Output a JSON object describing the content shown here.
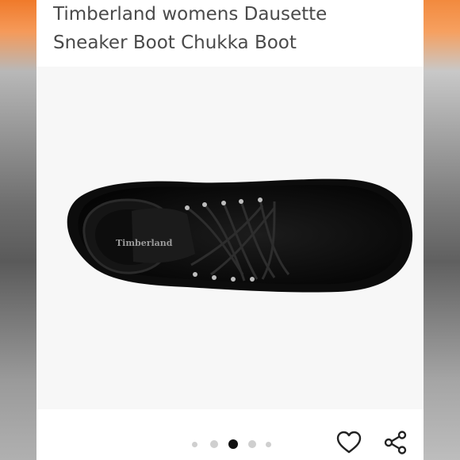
{
  "product": {
    "title_line1": "Timberland womens Dausette",
    "title_line2": "Sneaker Boot Chukka Boot",
    "image_brand_text": "Timberland"
  },
  "carousel": {
    "total_images": 5,
    "active_index": 2
  },
  "actions": {
    "favorite_icon": "heart-icon",
    "share_icon": "share-icon"
  },
  "colors": {
    "title_text": "#4a4a4a",
    "active_dot": "#111111",
    "inactive_dot": "#cfcfcf",
    "accent_bar": "#f07a2a"
  }
}
